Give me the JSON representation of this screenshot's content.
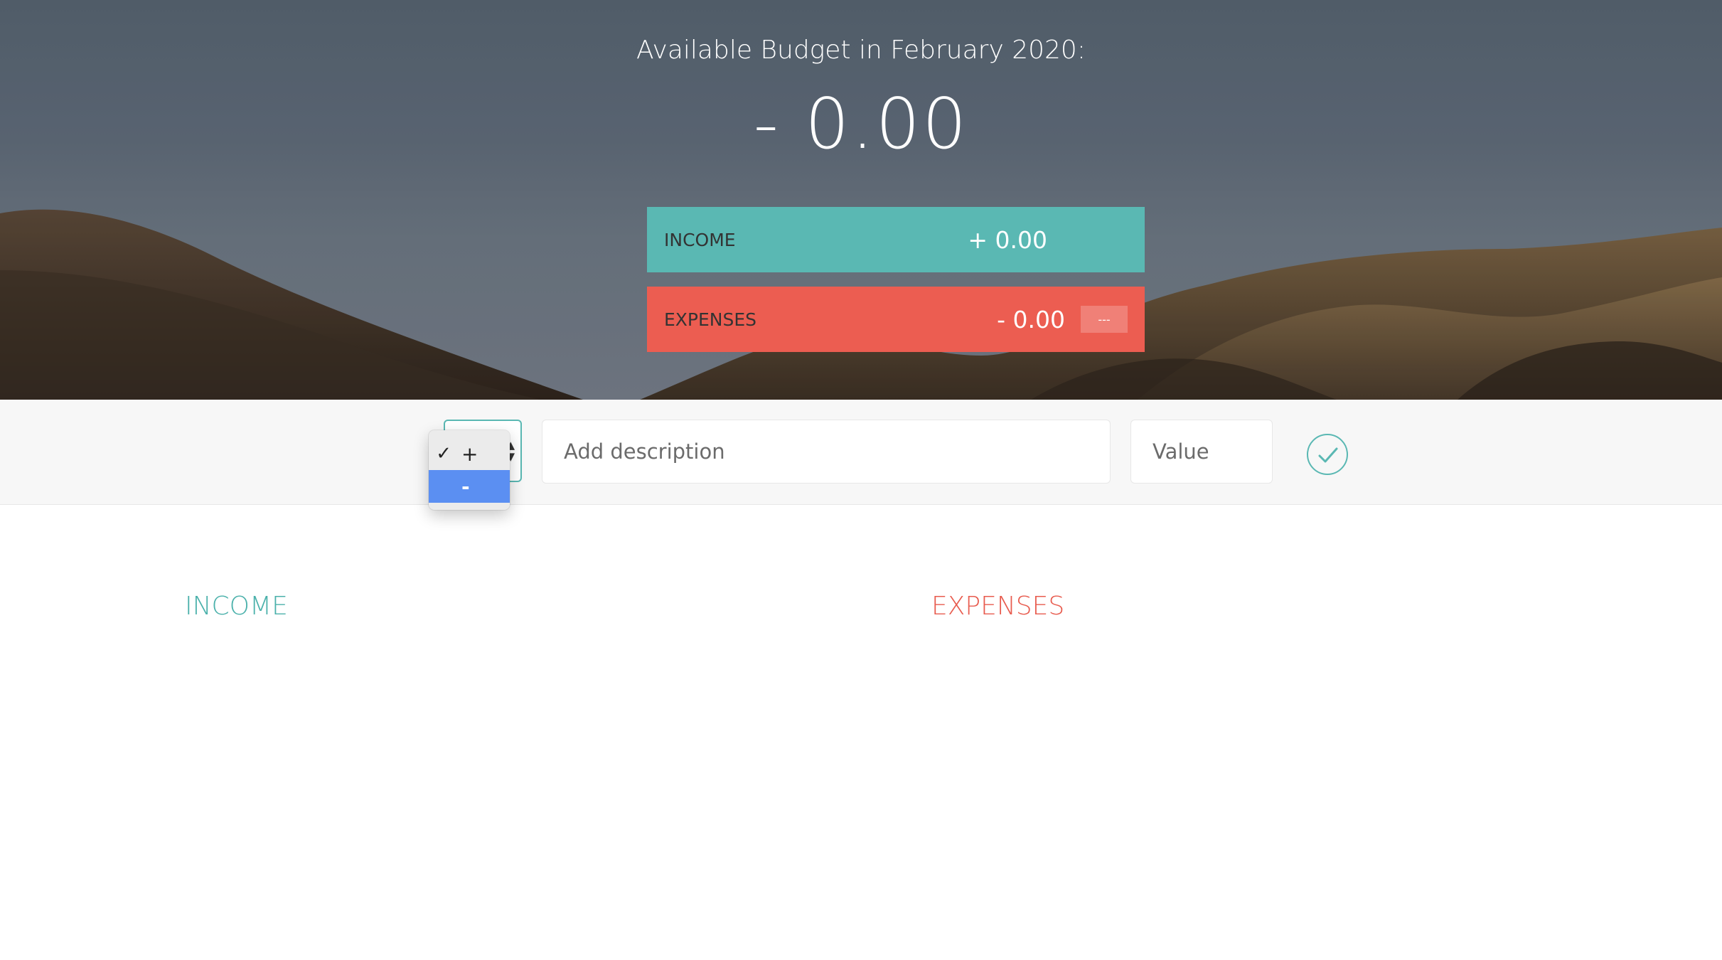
{
  "header": {
    "title": "Available Budget in February 2020:",
    "budget_value": "- 0.00",
    "income": {
      "label": "INCOME",
      "value": "+ 0.00"
    },
    "expenses": {
      "label": "EXPENSES",
      "value": "- 0.00",
      "percentage": "---"
    }
  },
  "add_form": {
    "type_options": [
      "+",
      "-"
    ],
    "type_selected": "+",
    "type_checkmark": "✓",
    "description_placeholder": "Add description",
    "value_placeholder": "Value",
    "submit_icon": "check-circle-icon"
  },
  "lists": {
    "income_title": "INCOME",
    "expenses_title": "EXPENSES"
  },
  "colors": {
    "income": "#5ab8b3",
    "expenses": "#ec5d51",
    "highlight": "#5b8ff2"
  }
}
